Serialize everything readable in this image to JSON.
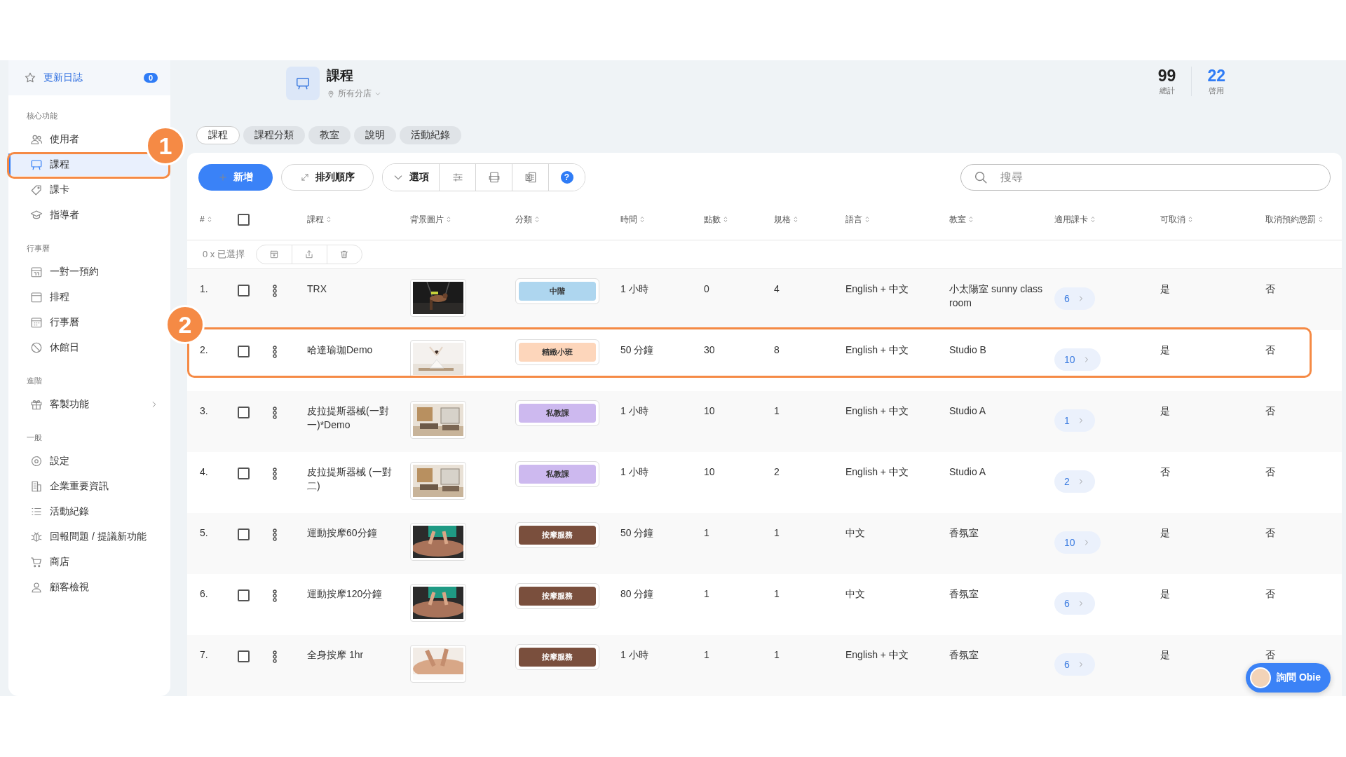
{
  "sidebar": {
    "changelog": {
      "label": "更新日誌",
      "count": "0"
    },
    "sections": [
      {
        "title": "核心功能",
        "items": [
          {
            "label": "使用者",
            "kind": "link",
            "selected": false
          },
          {
            "label": "課程",
            "kind": "link",
            "selected": true
          },
          {
            "label": "課卡",
            "kind": "link",
            "selected": false
          },
          {
            "label": "指導者",
            "kind": "link",
            "selected": false
          }
        ]
      },
      {
        "title": "行事曆",
        "items": [
          {
            "label": "一對一預約",
            "kind": "link",
            "selected": false
          },
          {
            "label": "排程",
            "kind": "link",
            "selected": false
          },
          {
            "label": "行事曆",
            "kind": "link",
            "selected": false
          },
          {
            "label": "休館日",
            "kind": "link",
            "selected": false
          }
        ]
      },
      {
        "title": "進階",
        "items": [
          {
            "label": "客製功能",
            "kind": "submenu",
            "selected": false
          }
        ]
      },
      {
        "title": "一般",
        "items": [
          {
            "label": "設定",
            "kind": "link",
            "selected": false
          },
          {
            "label": "企業重要資訊",
            "kind": "link",
            "selected": false
          },
          {
            "label": "活動紀錄",
            "kind": "link",
            "selected": false
          },
          {
            "label": "回報問題 / 提議新功能",
            "kind": "link",
            "selected": false
          },
          {
            "label": "商店",
            "kind": "link",
            "selected": false
          },
          {
            "label": "顧客檢視",
            "kind": "link",
            "selected": false
          }
        ]
      }
    ]
  },
  "header": {
    "title": "課程",
    "branch": "所有分店",
    "stats": [
      {
        "value": "99",
        "label": "總計",
        "kind": "total"
      },
      {
        "value": "22",
        "label": "啓用",
        "kind": "active"
      }
    ]
  },
  "tabs": [
    {
      "label": "課程",
      "selected": true
    },
    {
      "label": "課程分類",
      "selected": false
    },
    {
      "label": "教室",
      "selected": false
    },
    {
      "label": "說明",
      "selected": false
    },
    {
      "label": "活動紀錄",
      "selected": false
    }
  ],
  "toolbar": {
    "add": "新增",
    "sort": "排列順序",
    "options": "選項",
    "help": "?",
    "search": {
      "placeholder": "搜尋"
    }
  },
  "table": {
    "columns": [
      "#",
      "課程",
      "背景圖片",
      "分類",
      "時間",
      "點數",
      "規格",
      "語言",
      "教室",
      "適用課卡",
      "可取消",
      "取消預約懲罰"
    ],
    "header_checked": false,
    "selection": "0 x 已選擇",
    "rows": [
      {
        "number": "1.",
        "checked": false,
        "name": "TRX",
        "category": {
          "label": "中階",
          "color": "#aed6ef"
        },
        "time": "1 小時",
        "points": "0",
        "spec": "4",
        "language": "English + 中文",
        "room": "小太陽室 sunny class room",
        "cards": "6",
        "cancellable": "是",
        "penalty": "否"
      },
      {
        "number": "2.",
        "checked": false,
        "name": "哈達瑜珈Demo",
        "category": {
          "label": "精緻小班",
          "color": "#fdd6bb"
        },
        "time": "50 分鐘",
        "points": "30",
        "spec": "8",
        "language": "English + 中文",
        "room": "Studio B",
        "cards": "10",
        "cancellable": "是",
        "penalty": "否"
      },
      {
        "number": "3.",
        "checked": false,
        "name": "皮拉提斯器械(一對一)*Demo",
        "category": {
          "label": "私教課",
          "color": "#cdb9ef"
        },
        "time": "1 小時",
        "points": "10",
        "spec": "1",
        "language": "English + 中文",
        "room": "Studio A",
        "cards": "1",
        "cancellable": "是",
        "penalty": "否"
      },
      {
        "number": "4.",
        "checked": false,
        "name": "皮拉提斯器械 (一對二)",
        "category": {
          "label": "私教課",
          "color": "#cdb9ef"
        },
        "time": "1 小時",
        "points": "10",
        "spec": "2",
        "language": "English + 中文",
        "room": "Studio A",
        "cards": "2",
        "cancellable": "否",
        "penalty": "否"
      },
      {
        "number": "5.",
        "checked": false,
        "name": "運動按摩60分鐘",
        "category": {
          "label": "按摩服務",
          "color": "#7a4f3d"
        },
        "time": "50 分鐘",
        "points": "1",
        "spec": "1",
        "language": "中文",
        "room": "香氛室",
        "cards": "10",
        "cancellable": "是",
        "penalty": "否"
      },
      {
        "number": "6.",
        "checked": false,
        "name": "運動按摩120分鐘",
        "category": {
          "label": "按摩服務",
          "color": "#7a4f3d"
        },
        "time": "80 分鐘",
        "points": "1",
        "spec": "1",
        "language": "中文",
        "room": "香氛室",
        "cards": "6",
        "cancellable": "是",
        "penalty": "否"
      },
      {
        "number": "7.",
        "checked": false,
        "name": "全身按摩 1hr",
        "category": {
          "label": "按摩服務",
          "color": "#7a4f3d"
        },
        "time": "1 小時",
        "points": "1",
        "spec": "1",
        "language": "English + 中文",
        "room": "香氛室",
        "cards": "6",
        "cancellable": "是",
        "penalty": "否"
      }
    ]
  },
  "chat_button": {
    "label": "詢問 Obie"
  },
  "annotations": [
    {
      "label": "1"
    },
    {
      "label": "2"
    }
  ]
}
